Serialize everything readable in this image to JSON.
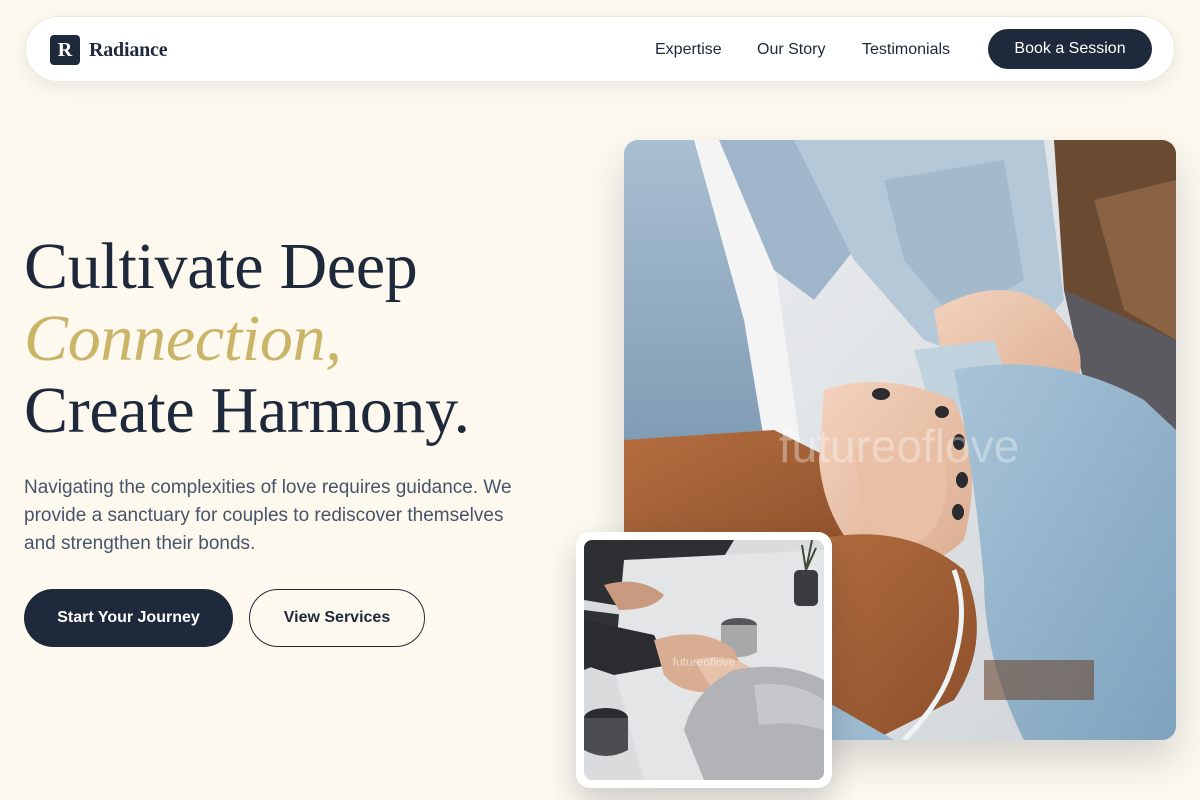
{
  "brand": {
    "mark": "R",
    "name": "Radiance"
  },
  "nav": {
    "links": [
      "Expertise",
      "Our Story",
      "Testimonials"
    ],
    "cta_label": "Book a Session"
  },
  "hero": {
    "headline_line1": "Cultivate Deep",
    "headline_accent": "Connection,",
    "headline_line3": "Create Harmony.",
    "description": "Navigating the complexities of love requires guidance. We provide a sanctuary for couples to rediscover themselves and strengthen their bonds.",
    "primary_cta": "Start Your Journey",
    "secondary_cta": "View Services"
  },
  "images": {
    "main_watermark": "futureoflove",
    "small_watermark": "futureoflove"
  },
  "colors": {
    "background": "#fdf9ef",
    "navy": "#1e293b",
    "accent_gold": "#c9b468",
    "body_text": "#475569"
  }
}
